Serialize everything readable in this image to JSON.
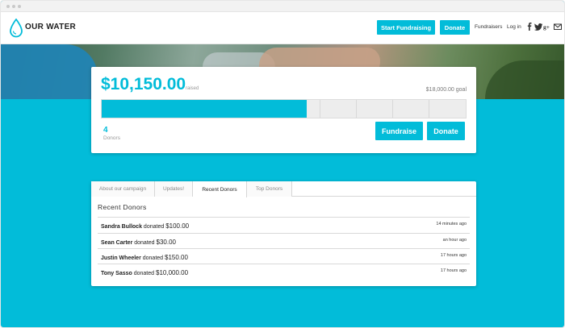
{
  "header": {
    "brand": "OUR WATER",
    "start_fundraising": "Start Fundraising",
    "donate": "Donate",
    "fundraisers": "Fundraisers",
    "login": "Log in",
    "social_icons": [
      "facebook-icon",
      "twitter-icon",
      "google-plus-icon",
      "email-icon"
    ]
  },
  "campaign": {
    "raised_amount": "$10,150.00",
    "raised_label": "raised",
    "goal": "$18,000.00 goal",
    "progress_fraction": 0.564,
    "donors_count": "4",
    "donors_label": "Donors",
    "fundraise_button": "Fundraise",
    "donate_button": "Donate"
  },
  "tabs": [
    {
      "label": "About our campaign",
      "active": false
    },
    {
      "label": "Updates!",
      "active": false
    },
    {
      "label": "Recent Donors",
      "active": true
    },
    {
      "label": "Top Donors",
      "active": false
    }
  ],
  "recent_donors": {
    "title": "Recent Donors",
    "donated_word": "donated",
    "rows": [
      {
        "name": "Sandra Bullock",
        "amount": "$100.00",
        "time": "14 minutes ago"
      },
      {
        "name": "Sean Carter",
        "amount": "$30.00",
        "time": "an hour ago"
      },
      {
        "name": "Justin Wheeler",
        "amount": "$150.00",
        "time": "17 hours ago"
      },
      {
        "name": "Tony Sasso",
        "amount": "$10,000.00",
        "time": "17 hours ago"
      }
    ]
  },
  "colors": {
    "accent": "#02bcd9",
    "page_background": "#02bcd9"
  }
}
